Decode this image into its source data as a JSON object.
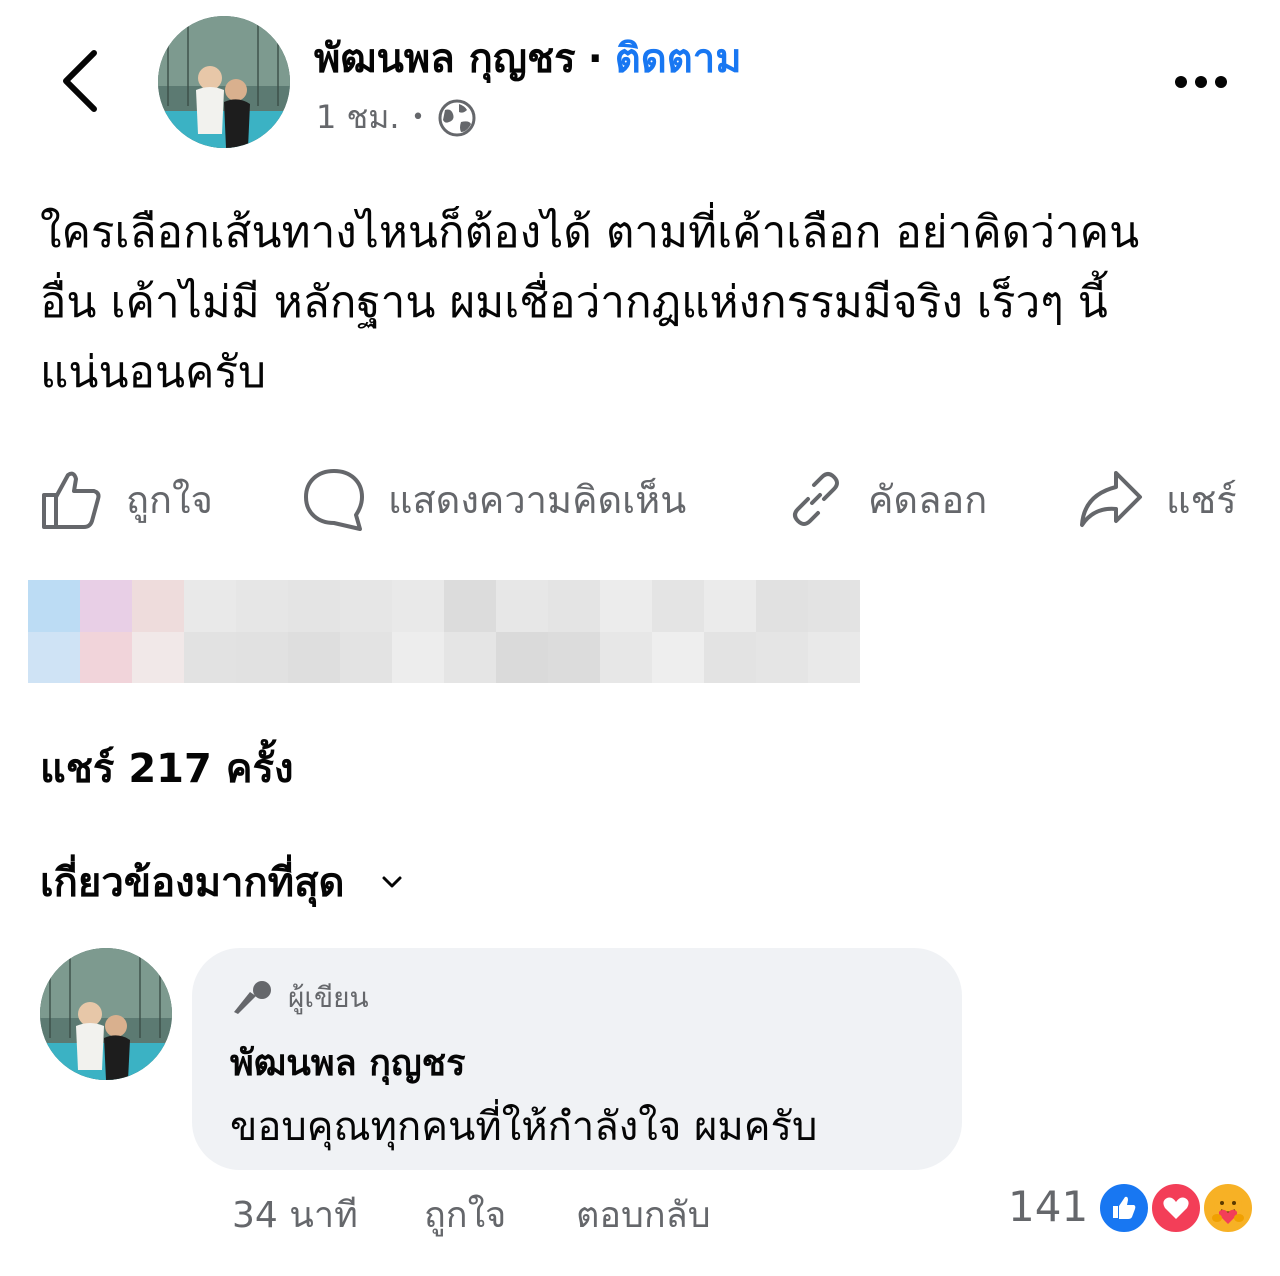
{
  "header": {
    "author_name": "พัฒนพล กุญชร",
    "separator": "·",
    "follow_label": "ติดตาม",
    "time": "1 ชม.",
    "time_separator": "•",
    "privacy_icon": "globe-icon"
  },
  "post": {
    "text_line1": "ใครเลือกเส้นทางไหนก็ต้องได้ ตามที่เค้าเลือก อย่าคิดว่าคน",
    "text_line2": "อื่น เค้าไม่มี หลักฐาน ผมเชื่อว่ากฎแห่งกรรมมีจริง เร็วๆ นี้",
    "text_line3": "แน่นอนครับ"
  },
  "actions": {
    "like": "ถูกใจ",
    "comment": "แสดงความคิดเห็น",
    "copy": "คัดลอก",
    "share": "แชร์"
  },
  "stats": {
    "share_count": "แชร์ 217 ครั้ง"
  },
  "comments_sort": {
    "selected": "เกี่ยวข้องมากที่สุด"
  },
  "comment": {
    "badge": "ผู้เขียน",
    "author_name": "พัฒนพล กุญชร",
    "text": "ขอบคุณทุกคนที่ให้กำลังใจ ผมครับ",
    "time": "34 นาที",
    "like_label": "ถูกใจ",
    "reply_label": "ตอบกลับ",
    "reaction_count": "141",
    "reactions": [
      "like-reaction-icon",
      "love-reaction-icon",
      "care-reaction-icon"
    ]
  },
  "colors": {
    "accent": "#1877f2",
    "secondary_text": "#65676b",
    "bubble_bg": "#f0f2f5",
    "love": "#f33e58",
    "care": "#f7b125"
  }
}
